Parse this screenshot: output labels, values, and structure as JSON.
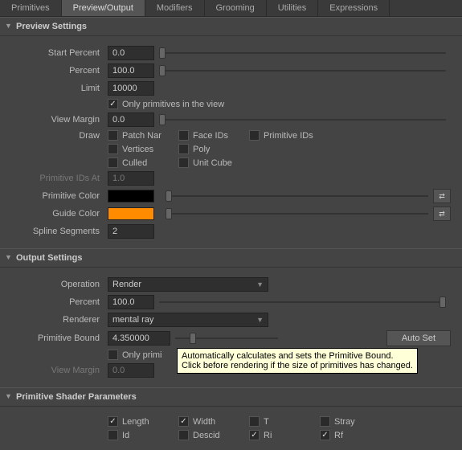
{
  "tabs": {
    "primitives": "Primitives",
    "preview": "Preview/Output",
    "modifiers": "Modifiers",
    "grooming": "Grooming",
    "utilities": "Utilities",
    "expressions": "Expressions"
  },
  "preview": {
    "title": "Preview Settings",
    "start_percent_label": "Start Percent",
    "start_percent": "0.0",
    "percent_label": "Percent",
    "percent": "100.0",
    "limit_label": "Limit",
    "limit": "10000",
    "only_view": "Only primitives in the view",
    "view_margin_label": "View Margin",
    "view_margin": "0.0",
    "draw_label": "Draw",
    "draw_patch": "Patch Nar",
    "draw_faceids": "Face IDs",
    "draw_primids": "Primitive IDs",
    "draw_vertices": "Vertices",
    "draw_poly": "Poly",
    "draw_culled": "Culled",
    "draw_unitcube": "Unit Cube",
    "primids_at_label": "Primitive IDs At",
    "primids_at": "1.0",
    "prim_color_label": "Primitive Color",
    "prim_color": "#000000",
    "guide_color_label": "Guide Color",
    "guide_color": "#ff8c00",
    "spline_seg_label": "Spline Segments",
    "spline_seg": "2"
  },
  "output": {
    "title": "Output Settings",
    "operation_label": "Operation",
    "operation": "Render",
    "percent_label": "Percent",
    "percent": "100.0",
    "renderer_label": "Renderer",
    "renderer": "mental ray",
    "primbound_label": "Primitive Bound",
    "primbound": "4.350000",
    "autoset": "Auto Set",
    "only_view": "Only primi",
    "view_margin_label": "View Margin",
    "view_margin": "0.0",
    "tooltip_l1": "Automatically calculates and sets the Primitive Bound.",
    "tooltip_l2": "Click before rendering if the size of primitives has changed."
  },
  "shader": {
    "title": "Primitive Shader Parameters",
    "length": "Length",
    "width": "Width",
    "t": "T",
    "stray": "Stray",
    "id": "Id",
    "descid": "Descid",
    "ri": "Ri",
    "rf": "Rf"
  }
}
